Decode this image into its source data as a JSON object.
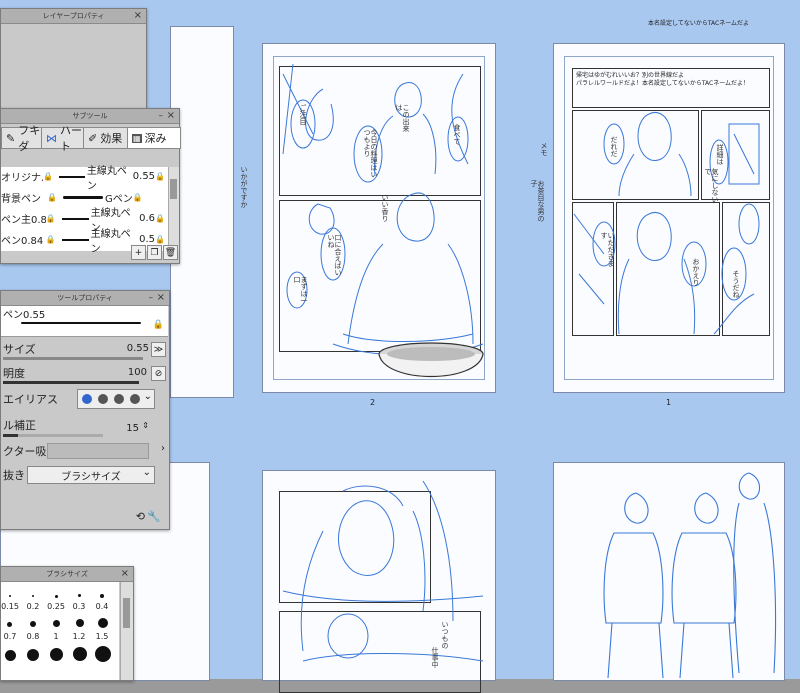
{
  "canvas": {
    "page_numbers": {
      "left_top": "2",
      "right_top": "1"
    },
    "header_lines": [
      "本名設定してないからTACネームだよ",
      "帰宅はゆがむれいいお？別の世界線だよ",
      "パラレルワールドだよ！本名設定してないからTACネームだよ！"
    ],
    "side_notes": [
      "いかがですか",
      "出会いの話",
      "いつもの",
      "メモ",
      "お茶目な男の子",
      "仕事中"
    ],
    "bubbles_left": [
      "今日の料理はいつもより",
      "ご注目",
      "食べて",
      "口に合えばいいね",
      "この出来は",
      "いい香り",
      "まずは一口"
    ],
    "bubbles_right": [
      "だれだ",
      "詳細は",
      "気にしないで",
      "おかえり",
      "いただきます",
      "そうだね"
    ]
  },
  "layer_property": {
    "title": "レイヤープロパティ"
  },
  "subtool": {
    "title": "サブツール",
    "tabs": [
      "フキダ",
      "ハート",
      "効果",
      "深み"
    ],
    "brushes": [
      {
        "left": "オリジナル",
        "right": "主線丸ペン",
        "value": "0.55"
      },
      {
        "left": "背景ペン",
        "right": "Gペン",
        "value": ""
      },
      {
        "left": "ペン主0.88",
        "right": "主線丸ペン",
        "value": "0.6"
      },
      {
        "left": "ペン0.84",
        "right": "主線丸ペン",
        "value": "0.5"
      }
    ]
  },
  "tool_property": {
    "title": "ツールプロパティ",
    "brush_name": "ペン0.55",
    "size_label": "サイズ",
    "size_value": "0.55",
    "opacity_label": "明度",
    "opacity_value": "100",
    "opacity_fraction": 1.0,
    "aa_label": "エイリアス",
    "correction_label": "ル補正",
    "correction_value": "15",
    "correction_fraction": 0.15,
    "vector_label": "クター吸着",
    "taper_label": "抜き",
    "taper_value": "ブラシサイズ"
  },
  "brush_size": {
    "title": "ブラシサイズ",
    "row1": [
      "0.15",
      "0.2",
      "0.25",
      "0.3",
      "0.4"
    ],
    "row2": [
      "0.7",
      "0.8",
      "1",
      "1.2",
      "1.5"
    ]
  },
  "colors": {
    "sketch_blue": "#3a78d8",
    "sheet_blue": "#a9c8f0",
    "panel_gray": "#c9c9c9"
  }
}
